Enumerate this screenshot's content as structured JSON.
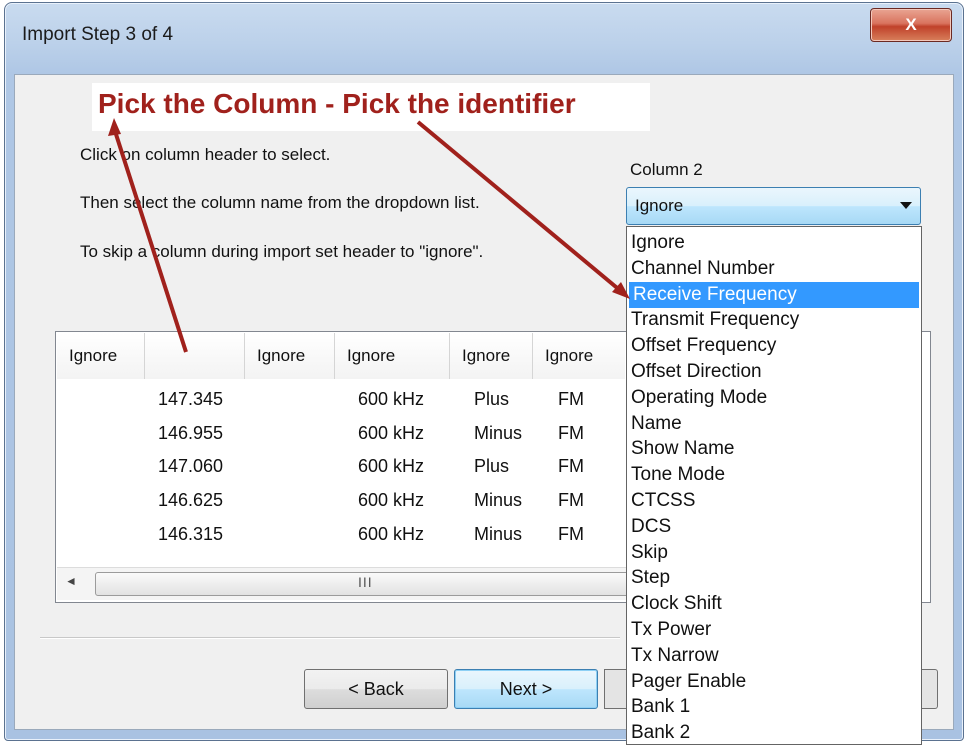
{
  "window": {
    "title": "Import Step 3 of 4",
    "close_label": "X"
  },
  "annotation": {
    "text": "Pick the Column - Pick the identifier",
    "color": "#a0211c"
  },
  "instructions": [
    "Click on column header to select.",
    "Then select the column name from the dropdown list.",
    "To skip a column during import set header to \"ignore\"."
  ],
  "column_selector": {
    "label": "Column 2",
    "selected": "Ignore",
    "options": [
      "Ignore",
      "Channel Number",
      "Receive Frequency",
      "Transmit Frequency",
      "Offset Frequency",
      "Offset Direction",
      "Operating Mode",
      "Name",
      "Show Name",
      "Tone Mode",
      "CTCSS",
      "DCS",
      "Skip",
      "Step",
      "Clock Shift",
      "Tx Power",
      "Tx Narrow",
      "Pager Enable",
      "Bank 1",
      "Bank 2"
    ],
    "highlighted_option": "Receive Frequency",
    "highlight_color": "#3399ff"
  },
  "grid": {
    "headers": [
      "Ignore",
      "",
      "Ignore",
      "Ignore",
      "Ignore",
      "Ignore"
    ],
    "rows": [
      [
        "",
        "147.345",
        "",
        "600 kHz",
        "Plus",
        "FM"
      ],
      [
        "",
        "146.955",
        "",
        "600 kHz",
        "Minus",
        "FM"
      ],
      [
        "",
        "147.060",
        "",
        "600 kHz",
        "Plus",
        "FM"
      ],
      [
        "",
        "146.625",
        "",
        "600 kHz",
        "Minus",
        "FM"
      ],
      [
        "",
        "146.315",
        "",
        "600 kHz",
        "Minus",
        "FM"
      ]
    ],
    "scroll_left_icon": "◄",
    "scroll_grip": "III"
  },
  "buttons": {
    "back": "< Back",
    "next": "Next >"
  }
}
